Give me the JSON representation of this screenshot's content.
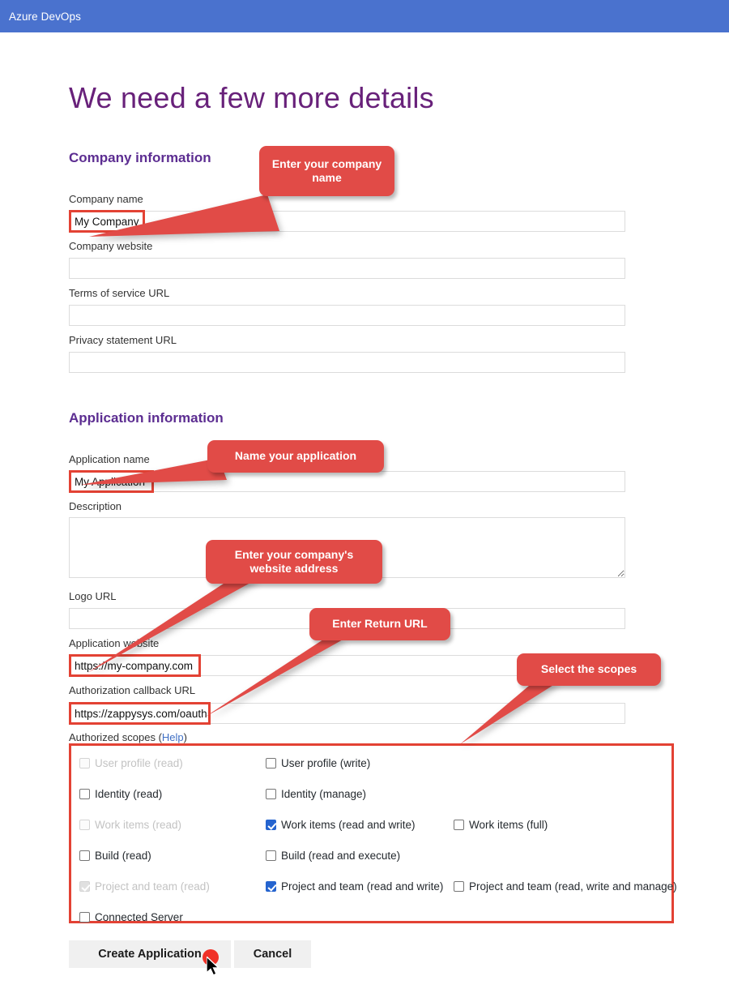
{
  "topbar": {
    "brand": "Azure DevOps",
    "bg": "#4a72ce"
  },
  "page": {
    "title": "We need a few more details",
    "title_color": "#68217a"
  },
  "sections": [
    {
      "id": "company",
      "title": "Company information"
    },
    {
      "id": "application",
      "title": "Application information"
    }
  ],
  "fields": {
    "company_name": {
      "label": "Company name",
      "value": "My Company",
      "placeholder": ""
    },
    "company_website": {
      "label": "Company website",
      "value": "",
      "placeholder": ""
    },
    "terms_of_service": {
      "label": "Terms of service URL",
      "value": "",
      "placeholder": ""
    },
    "privacy_statement": {
      "label": "Privacy statement URL",
      "value": "",
      "placeholder": ""
    },
    "application_name": {
      "label": "Application name",
      "value": "My Application",
      "placeholder": ""
    },
    "description": {
      "label": "Description",
      "value": "",
      "placeholder": ""
    },
    "logo_url": {
      "label": "Logo URL",
      "value": "",
      "placeholder": ""
    },
    "application_website": {
      "label": "Application website",
      "value": "https://my-company.com",
      "placeholder": ""
    },
    "callback_url": {
      "label": "Authorization callback URL",
      "value": "https://zappysys.com/oauth",
      "placeholder": ""
    }
  },
  "scopes": {
    "label": "Authorized scopes",
    "help_text": "Help",
    "open_paren": " (",
    "close_paren": ")",
    "border_color": "#e34234",
    "checked_color": "#2564cf",
    "items": [
      {
        "label": "User profile (read)",
        "checked": false,
        "disabled": true,
        "col": 0,
        "row": 0
      },
      {
        "label": "User profile (write)",
        "checked": false,
        "disabled": false,
        "col": 1,
        "row": 0
      },
      {
        "label": "Identity (read)",
        "checked": false,
        "disabled": false,
        "col": 0,
        "row": 1
      },
      {
        "label": "Identity (manage)",
        "checked": false,
        "disabled": false,
        "col": 1,
        "row": 1
      },
      {
        "label": "Work items (read)",
        "checked": false,
        "disabled": true,
        "col": 0,
        "row": 2
      },
      {
        "label": "Work items (read and write)",
        "checked": true,
        "disabled": false,
        "col": 1,
        "row": 2
      },
      {
        "label": "Work items (full)",
        "checked": false,
        "disabled": false,
        "col": 2,
        "row": 2
      },
      {
        "label": "Build (read)",
        "checked": false,
        "disabled": false,
        "col": 0,
        "row": 3
      },
      {
        "label": "Build (read and execute)",
        "checked": false,
        "disabled": false,
        "col": 1,
        "row": 3
      },
      {
        "label": "Project and team (read)",
        "checked": true,
        "disabled": true,
        "col": 0,
        "row": 4
      },
      {
        "label": "Project and team (read and write)",
        "checked": true,
        "disabled": false,
        "col": 1,
        "row": 4
      },
      {
        "label": "Project and team (read, write and manage)",
        "checked": false,
        "disabled": false,
        "col": 2,
        "row": 4
      },
      {
        "label": "Connected Server",
        "checked": false,
        "disabled": false,
        "col": 0,
        "row": 5
      }
    ]
  },
  "buttons": {
    "create": "Create Application",
    "cancel": "Cancel"
  },
  "callouts": [
    {
      "id": "company-name",
      "text": "Enter your company name"
    },
    {
      "id": "app-name",
      "text": "Name your application"
    },
    {
      "id": "app-website",
      "text": "Enter your company's website address"
    },
    {
      "id": "return-url",
      "text": "Enter Return URL"
    },
    {
      "id": "select-scopes",
      "text": "Select the scopes"
    }
  ],
  "annotation": {
    "color": "#e14b47",
    "click_marker_color": "#f03128"
  }
}
